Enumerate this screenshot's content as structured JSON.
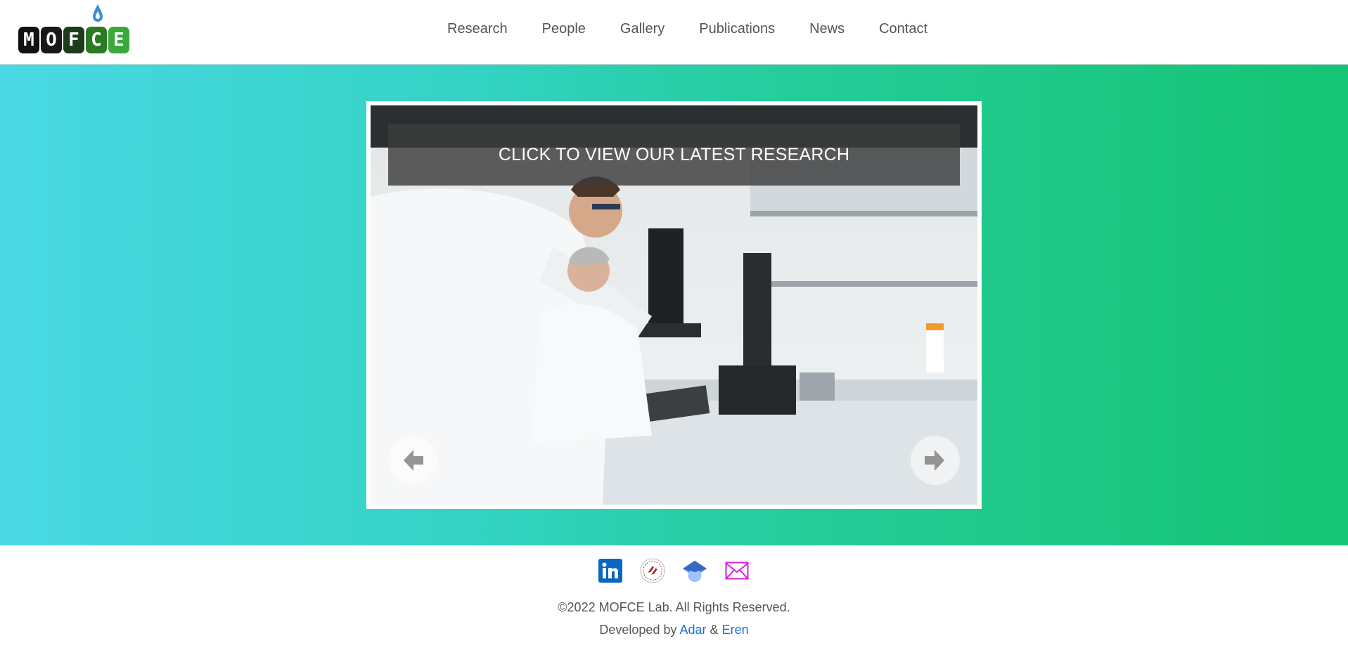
{
  "brand": {
    "logo_letters": [
      "M",
      "O",
      "F",
      "C",
      "E"
    ],
    "logo_colors": [
      "#111111",
      "#181818",
      "#1e3b1e",
      "#2b7a25",
      "#3aa83a"
    ],
    "drop_color": "#3b8fd9"
  },
  "nav": {
    "items": [
      {
        "label": "Research"
      },
      {
        "label": "People"
      },
      {
        "label": "Gallery"
      },
      {
        "label": "Publications"
      },
      {
        "label": "News"
      },
      {
        "label": "Contact"
      }
    ]
  },
  "hero": {
    "gradient": [
      "#4ad8e4",
      "#15c474"
    ],
    "slider": {
      "banner_text": "CLICK TO VIEW OUR LATEST RESEARCH",
      "prev_icon": "arrow-left-icon",
      "next_icon": "arrow-right-icon"
    }
  },
  "footer": {
    "socials": [
      {
        "icon": "linkedin-icon",
        "color": "#0a66c2"
      },
      {
        "icon": "university-seal-icon",
        "color": "#a41d22"
      },
      {
        "icon": "graduation-cap-icon",
        "color": "#4285f4"
      },
      {
        "icon": "mail-icon",
        "color": "#d81ce0"
      }
    ],
    "copyright": "©2022 MOFCE Lab. All Rights Reserved.",
    "developed_by_prefix": "Developed by",
    "dev_1": "Adar",
    "separator": "&",
    "dev_2": "Eren"
  }
}
